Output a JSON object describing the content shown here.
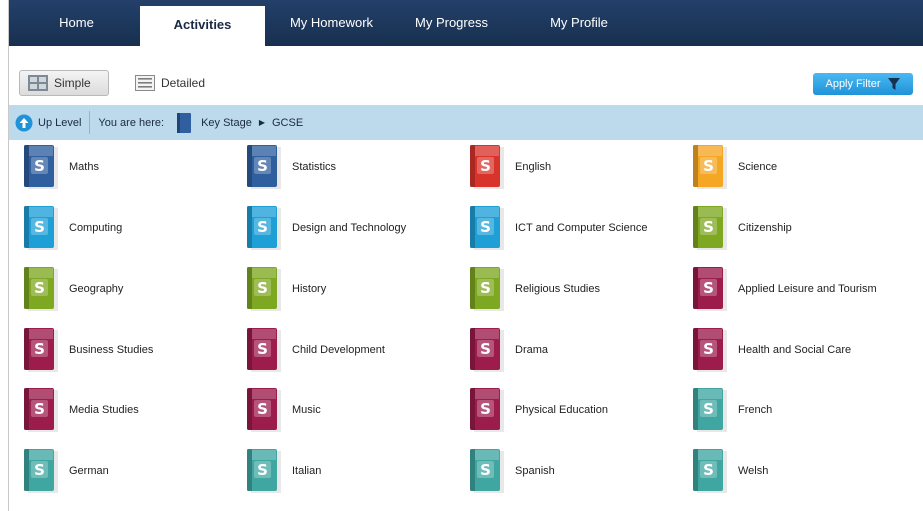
{
  "nav": {
    "tabs": [
      {
        "label": "Home",
        "active": false
      },
      {
        "label": "Activities",
        "active": true
      },
      {
        "label": "My Homework",
        "active": false
      },
      {
        "label": "My Progress",
        "active": false
      },
      {
        "label": "My Profile",
        "active": false
      }
    ]
  },
  "toolbar": {
    "simple_label": "Simple",
    "detailed_label": "Detailed",
    "apply_filter_label": "Apply Filter"
  },
  "breadcrumb": {
    "up_level_label": "Up Level",
    "here_label": "You are here:",
    "items": [
      "Key Stage",
      "GCSE"
    ]
  },
  "subjects": [
    {
      "name": "Maths",
      "color": "#2f5f9e"
    },
    {
      "name": "Statistics",
      "color": "#2f5f9e"
    },
    {
      "name": "English",
      "color": "#d9342b"
    },
    {
      "name": "Science",
      "color": "#f5a623"
    },
    {
      "name": "Computing",
      "color": "#1e9fd6"
    },
    {
      "name": "Design and Technology",
      "color": "#1e9fd6"
    },
    {
      "name": "ICT and Computer Science",
      "color": "#1e9fd6"
    },
    {
      "name": "Citizenship",
      "color": "#7ea722"
    },
    {
      "name": "Geography",
      "color": "#7ea722"
    },
    {
      "name": "History",
      "color": "#7ea722"
    },
    {
      "name": "Religious Studies",
      "color": "#7ea722"
    },
    {
      "name": "Applied Leisure and Tourism",
      "color": "#9c1c4c"
    },
    {
      "name": "Business Studies",
      "color": "#9c1c4c"
    },
    {
      "name": "Child Development",
      "color": "#9c1c4c"
    },
    {
      "name": "Drama",
      "color": "#9c1c4c"
    },
    {
      "name": "Health and Social Care",
      "color": "#9c1c4c"
    },
    {
      "name": "Media Studies",
      "color": "#9c1c4c"
    },
    {
      "name": "Music",
      "color": "#9c1c4c"
    },
    {
      "name": "Physical Education",
      "color": "#9c1c4c"
    },
    {
      "name": "French",
      "color": "#3fa6a2"
    },
    {
      "name": "German",
      "color": "#3fa6a2"
    },
    {
      "name": "Italian",
      "color": "#3fa6a2"
    },
    {
      "name": "Spanish",
      "color": "#3fa6a2"
    },
    {
      "name": "Welsh",
      "color": "#3fa6a2"
    }
  ],
  "book_letter": "S",
  "colors": {
    "nav_bg": "#1b3256",
    "crumb_bg": "#bdd9ec",
    "filter_button": "#1f93d8"
  }
}
